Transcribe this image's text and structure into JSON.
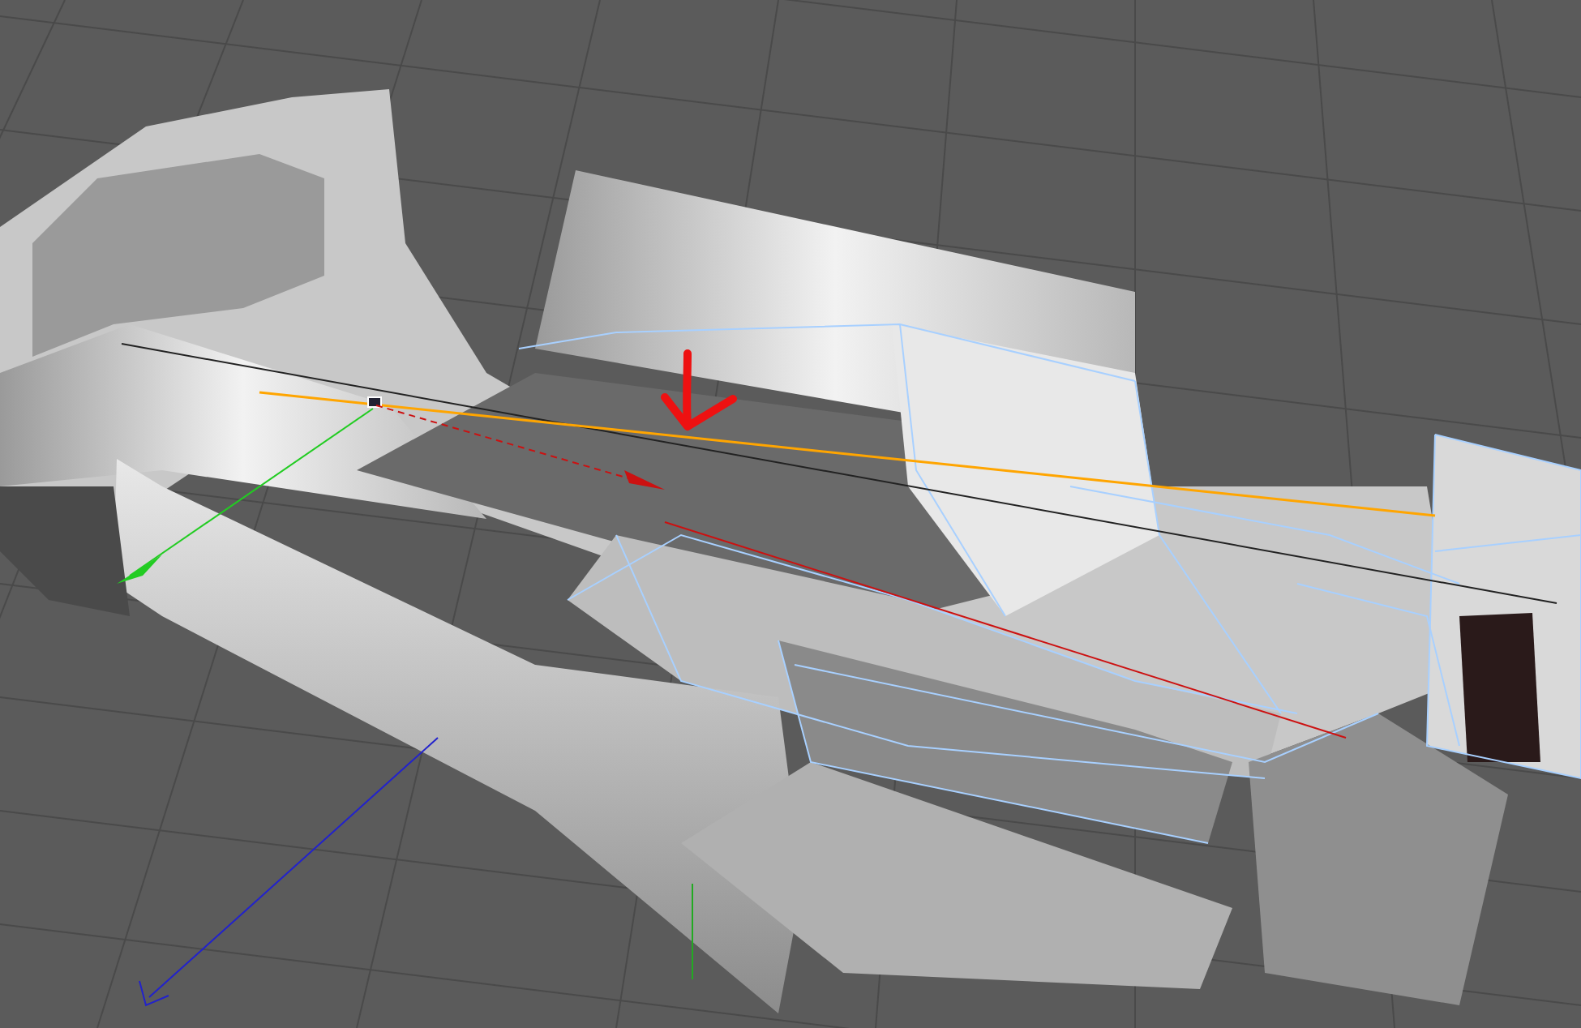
{
  "viewport": {
    "kind": "perspective",
    "grid": true,
    "wireframe": true,
    "guide_line": true,
    "axis_gizmo": true,
    "annotation_arrow": true
  }
}
